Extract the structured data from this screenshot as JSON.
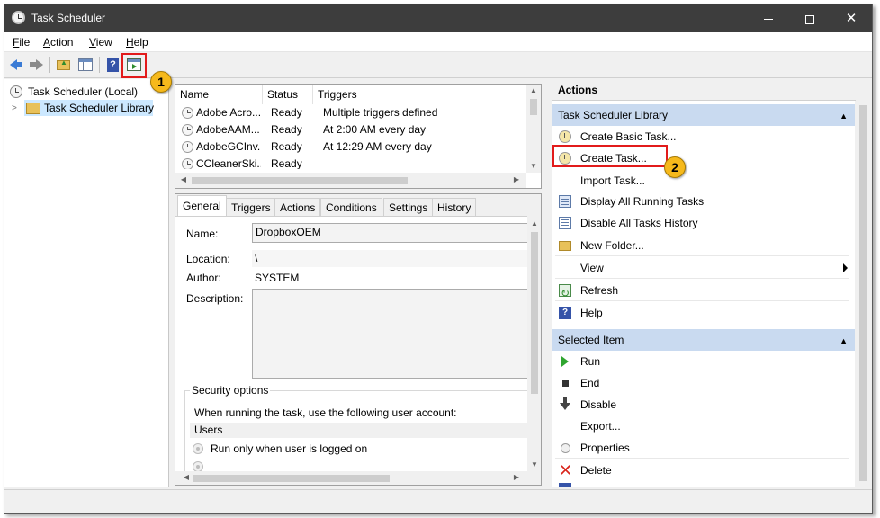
{
  "window": {
    "title": "Task Scheduler",
    "min_label": "",
    "max_label": "",
    "close_label": "✕"
  },
  "menu": {
    "file": "F",
    "file_rest": "ile",
    "action": "A",
    "action_rest": "ction",
    "view": "V",
    "view_rest": "iew",
    "help": "H",
    "help_rest": "elp"
  },
  "callouts": {
    "one": "1",
    "two": "2"
  },
  "tree": {
    "root": "Task Scheduler (Local)",
    "library": "Task Scheduler Library"
  },
  "task_list": {
    "columns": [
      "Name",
      "Status",
      "Triggers"
    ],
    "rows": [
      {
        "name": "Adobe Acro...",
        "status": "Ready",
        "triggers": "Multiple triggers defined"
      },
      {
        "name": "AdobeAAM...",
        "status": "Ready",
        "triggers": "At 2:00 AM every day"
      },
      {
        "name": "AdobeGCInv...",
        "status": "Ready",
        "triggers": "At 12:29 AM every day"
      },
      {
        "name": "CCleanerSki...",
        "status": "Ready",
        "triggers": ""
      }
    ]
  },
  "details": {
    "tabs": [
      "General",
      "Triggers",
      "Actions",
      "Conditions",
      "Settings",
      "History"
    ],
    "name_label": "Name:",
    "name_value": "DropboxOEM",
    "location_label": "Location:",
    "location_value": "\\",
    "author_label": "Author:",
    "author_value": "SYSTEM",
    "description_label": "Description:",
    "security_group": "Security options",
    "security_text": "When running the task, use the following user account:",
    "user_account": "Users",
    "radio_logged_on": "Run only when user is logged on"
  },
  "actions": {
    "title": "Actions",
    "library_section": "Task Scheduler Library",
    "library_items": [
      {
        "label": "Create Basic Task...",
        "icon": "create-basic-task-icon"
      },
      {
        "label": "Create Task...",
        "icon": "create-task-icon"
      },
      {
        "label": "Import Task...",
        "icon": ""
      },
      {
        "label": "Display All Running Tasks",
        "icon": "running-tasks-icon"
      },
      {
        "label": "Disable All Tasks History",
        "icon": "tasks-history-icon"
      },
      {
        "label": "New Folder...",
        "icon": "new-folder-icon"
      },
      {
        "label": "View",
        "icon": ""
      },
      {
        "label": "Refresh",
        "icon": "refresh-icon"
      },
      {
        "label": "Help",
        "icon": "help-icon"
      }
    ],
    "selected_section": "Selected Item",
    "selected_items": [
      {
        "label": "Run",
        "icon": "run-icon"
      },
      {
        "label": "End",
        "icon": "end-icon"
      },
      {
        "label": "Disable",
        "icon": "disable-icon"
      },
      {
        "label": "Export...",
        "icon": ""
      },
      {
        "label": "Properties",
        "icon": "properties-icon"
      },
      {
        "label": "Delete",
        "icon": "delete-icon"
      }
    ]
  },
  "colors": {
    "highlight": "#e21b1b",
    "callout": "#f6b91b",
    "section_header": "#c9daf0"
  }
}
